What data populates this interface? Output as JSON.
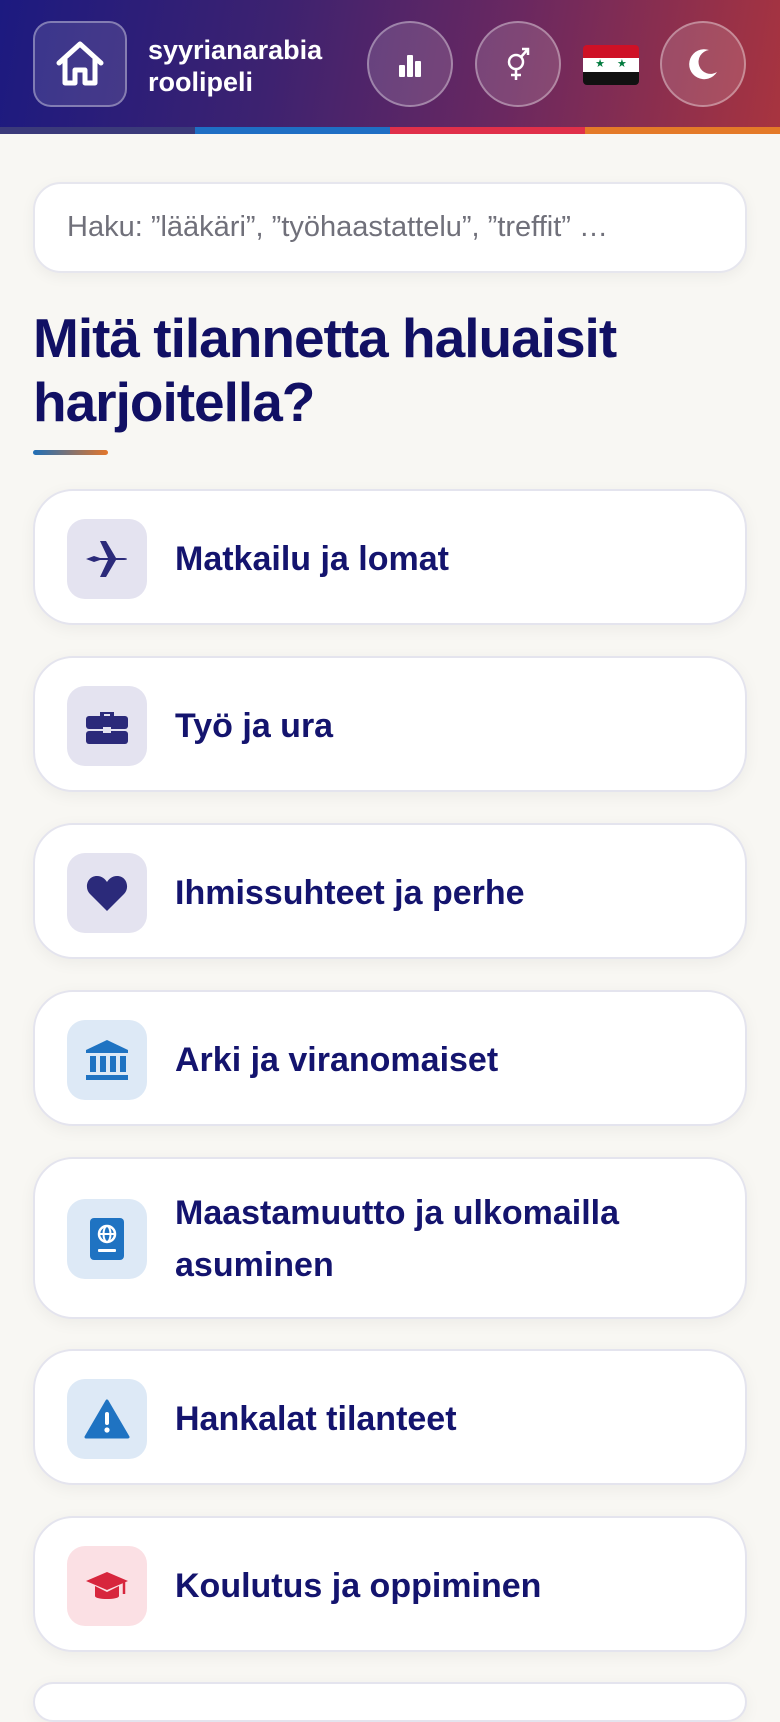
{
  "header": {
    "title_line1": "syyrianarabia",
    "title_line2": "roolipeli",
    "stripe_colors": [
      "#3b3a7a",
      "#1f6fc4",
      "#e0304a",
      "#e47a28"
    ]
  },
  "search": {
    "placeholder": "Haku: ”lääkäri”, ”työhaastattelu”, ”treffit” …"
  },
  "heading": {
    "line1": "Mitä tilannetta haluaisit",
    "line2": "harjoitella?"
  },
  "categories": [
    {
      "label": "Matkailu ja lomat",
      "icon": "airplane-icon"
    },
    {
      "label": "Työ ja ura",
      "icon": "briefcase-icon"
    },
    {
      "label": "Ihmissuhteet ja perhe",
      "icon": "heart-icon"
    },
    {
      "label": "Arki ja viranomaiset",
      "icon": "bank-icon"
    },
    {
      "label": "Maastamuutto ja ulkomailla asuminen",
      "icon": "passport-icon"
    },
    {
      "label": "Hankalat tilanteet",
      "icon": "warning-icon"
    },
    {
      "label": "Koulutus ja oppiminen",
      "icon": "graduation-cap-icon"
    }
  ],
  "colors": {
    "heading": "#111064",
    "icon_purple": "#2b2a7a",
    "icon_blue": "#1f73c2",
    "icon_red": "#d7263d"
  }
}
